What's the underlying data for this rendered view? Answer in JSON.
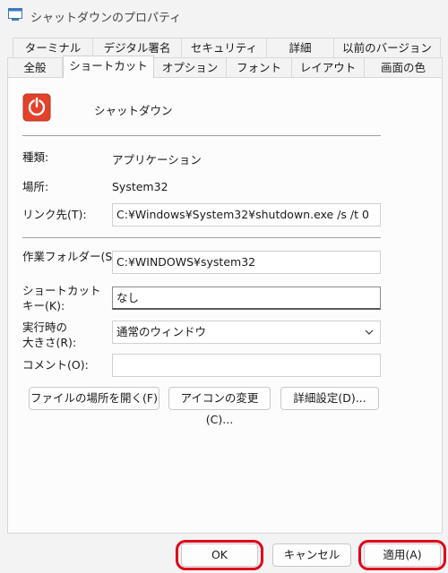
{
  "window": {
    "title": "シャットダウンのプロパティ"
  },
  "tabs_back": [
    "ターミナル",
    "デジタル署名",
    "セキュリティ",
    "詳細",
    "以前のバージョン"
  ],
  "tabs_front": [
    "全般",
    "ショートカット",
    "オプション",
    "フォント",
    "レイアウト",
    "画面の色"
  ],
  "active_tab": "ショートカット",
  "shortcut": {
    "name": "シャットダウン",
    "type_label": "種類:",
    "type_value": "アプリケーション",
    "location_label": "場所:",
    "location_value": "System32",
    "target_label": "リンク先(T):",
    "target_value": "C:¥Windows¥System32¥shutdown.exe /s /t 0",
    "workdir_label": "作業フォルダー(S):",
    "workdir_value": "C:¥WINDOWS¥system32",
    "hotkey_label_1": "ショートカット",
    "hotkey_label_2": "キー(K):",
    "hotkey_value": "なし",
    "run_label_1": "実行時の",
    "run_label_2": "大きさ(R):",
    "run_value": "通常のウィンドウ",
    "comment_label": "コメント(O):",
    "comment_value": ""
  },
  "buttons": {
    "open_location": "ファイルの場所を開く(F)",
    "change_icon": "アイコンの変更(C)...",
    "advanced": "詳細設定(D)...",
    "ok": "OK",
    "cancel": "キャンセル",
    "apply": "適用(A)"
  },
  "colors": {
    "highlight_ring": "#e0001a",
    "app_icon": "#e2412b"
  }
}
